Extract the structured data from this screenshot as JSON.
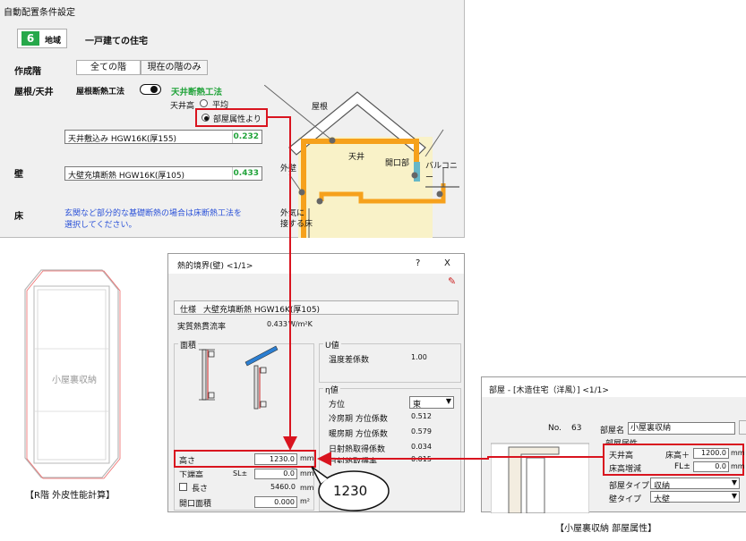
{
  "top": {
    "title": "自動配置条件設定",
    "region_num": "6",
    "region_label": "地域",
    "house_type": "一戸建ての住宅",
    "floor_label": "作成階",
    "floor_tab_all": "全ての階",
    "floor_tab_current": "現在の階のみ",
    "roof_label": "屋根/天井",
    "roof_ins_label": "屋根断熱工法",
    "ceiling_method": "天井断熱工法",
    "ceiling_height_label": "天井高",
    "ceiling_opt_flat": "平均",
    "ceiling_opt_room": "部屋属性より",
    "ceiling_spec": "天井敷込み HGW16K(厚155)",
    "ceiling_value": "0.232",
    "wall_label": "壁",
    "wall_spec": "大壁充填断熱 HGW16K(厚105)",
    "wall_value": "0.433",
    "floor2_label": "床",
    "floor_note1": "玄関など部分的な基礎断熱の場合は床断熱工法を",
    "floor_note2": "選択してください。",
    "diagram_roof": "屋根",
    "diagram_ceiling": "天井",
    "diagram_opening": "開口部",
    "diagram_balcony": "バルコニー",
    "diagram_outerwall": "外壁",
    "diagram_floor1": "外気に",
    "diagram_floor2": "接する床"
  },
  "plan": {
    "room_label": "小屋裏収納",
    "caption": "【R階 外皮性能計算】"
  },
  "wall_dialog": {
    "title": "熱的境界(壁) <1/1>",
    "help": "?",
    "close": "X",
    "spec_label": "仕様",
    "spec_value": "大壁充填断熱 HGW16K(厚105)",
    "heat_label": "実質熱貫流率",
    "heat_value": "0.433",
    "heat_unit": "W/m²K",
    "area_group": "面積",
    "u_group": "U値",
    "temp_label": "温度差係数",
    "temp_value": "1.00",
    "eta_group": "η値",
    "dir_label": "方位",
    "dir_value": "東",
    "cool_label": "冷房期 方位係数",
    "cool_value": "0.512",
    "heat2_label": "暖房期 方位係数",
    "heat2_value": "0.579",
    "solar_label": "日射熱取得係数",
    "solar_value": "0.034",
    "solar2_label": "日射熱取得率",
    "solar2_value": "0.015",
    "height_label": "高さ",
    "height_value": "1230.0",
    "height_unit": "mm",
    "bottom_label": "下端高",
    "sl_label": "SL±",
    "bottom_value": "0.0",
    "bottom_unit": "mm",
    "length_label": "長さ",
    "length_value": "5460.0",
    "length_unit": "mm",
    "opening_label": "開口面積",
    "opening_value": "0.000",
    "opening_unit": "m²"
  },
  "callout": {
    "text": "1230"
  },
  "room_dialog": {
    "title": "部屋 - [木造住宅（洋風）] <1/1>",
    "no_label": "No.",
    "no_value": "63",
    "name_label": "部屋名",
    "name_value": "小屋裏収納",
    "attr_label": "部屋属性",
    "ceil_label": "天井高",
    "ceil_prefix": "床高＋",
    "ceil_value": "1200.0",
    "ceil_unit": "mm",
    "fl_label": "床高増減",
    "fl_prefix": "FL±",
    "fl_value": "0.0",
    "fl_unit": "mm",
    "type_label": "部屋タイプ",
    "type_value": "収納",
    "wall_label": "壁タイプ",
    "wall_value": "大壁",
    "caption": "【小屋裏収納 部屋属性】"
  }
}
